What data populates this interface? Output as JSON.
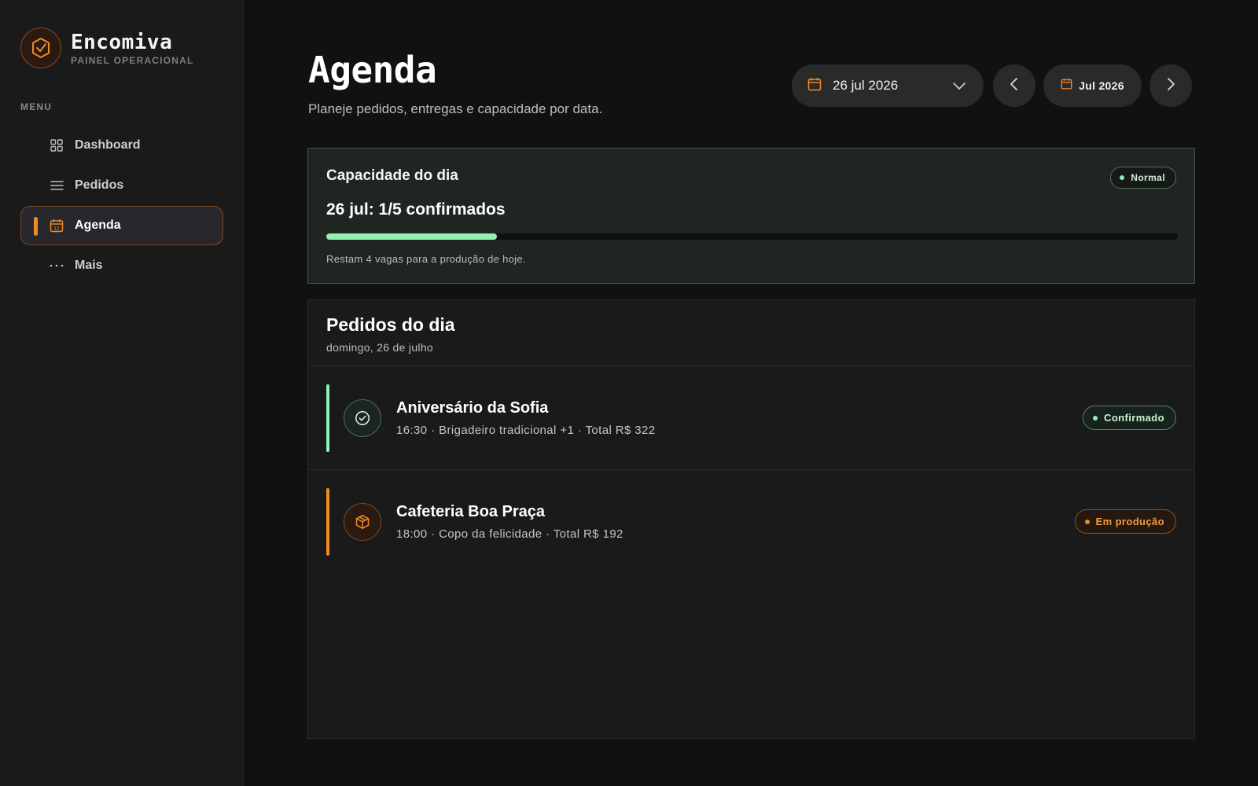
{
  "brand": {
    "name": "Encomiva",
    "subtitle": "PAINEL OPERACIONAL",
    "logo_icon": "box-check-icon",
    "accent": "#f08a24"
  },
  "sidebar": {
    "menu_label": "MENU",
    "items": [
      {
        "label": "Dashboard",
        "icon": "grid-icon",
        "active": false
      },
      {
        "label": "Pedidos",
        "icon": "list-icon",
        "active": false
      },
      {
        "label": "Agenda",
        "icon": "calendar-icon",
        "active": true
      },
      {
        "label": "Mais",
        "icon": "more-icon",
        "active": false
      }
    ]
  },
  "header": {
    "title": "Agenda",
    "subtitle": "Planeje pedidos, entregas e capacidade por data.",
    "date_picker": {
      "value": "26 jul 2026",
      "icon": "calendar-icon"
    },
    "prev_icon": "chevron-left-icon",
    "next_icon": "chevron-right-icon",
    "month": {
      "label": "Jul 2026",
      "icon": "calendar-icon"
    }
  },
  "capacity": {
    "title": "Capacidade do dia",
    "status": "Normal",
    "count_text": "26 jul: 1/5 confirmados",
    "confirmed": 1,
    "total": 5,
    "note": "Restam 4 vagas para a produção de hoje.",
    "bar_color": "#8ff0b0"
  },
  "orders": {
    "title": "Pedidos do dia",
    "date": "domingo, 26 de julho",
    "items": [
      {
        "name": "Aniversário da Sofia",
        "meta": "16:30 · Brigadeiro tradicional +1 · Total R$ 322",
        "status": "Confirmado",
        "icon": "check-circle-icon",
        "color": "#8ff0b0"
      },
      {
        "name": "Cafeteria Boa Praça",
        "meta": "18:00 · Copo da felicidade · Total R$ 192",
        "status": "Em produção",
        "icon": "package-icon",
        "color": "#f08a24"
      }
    ]
  }
}
